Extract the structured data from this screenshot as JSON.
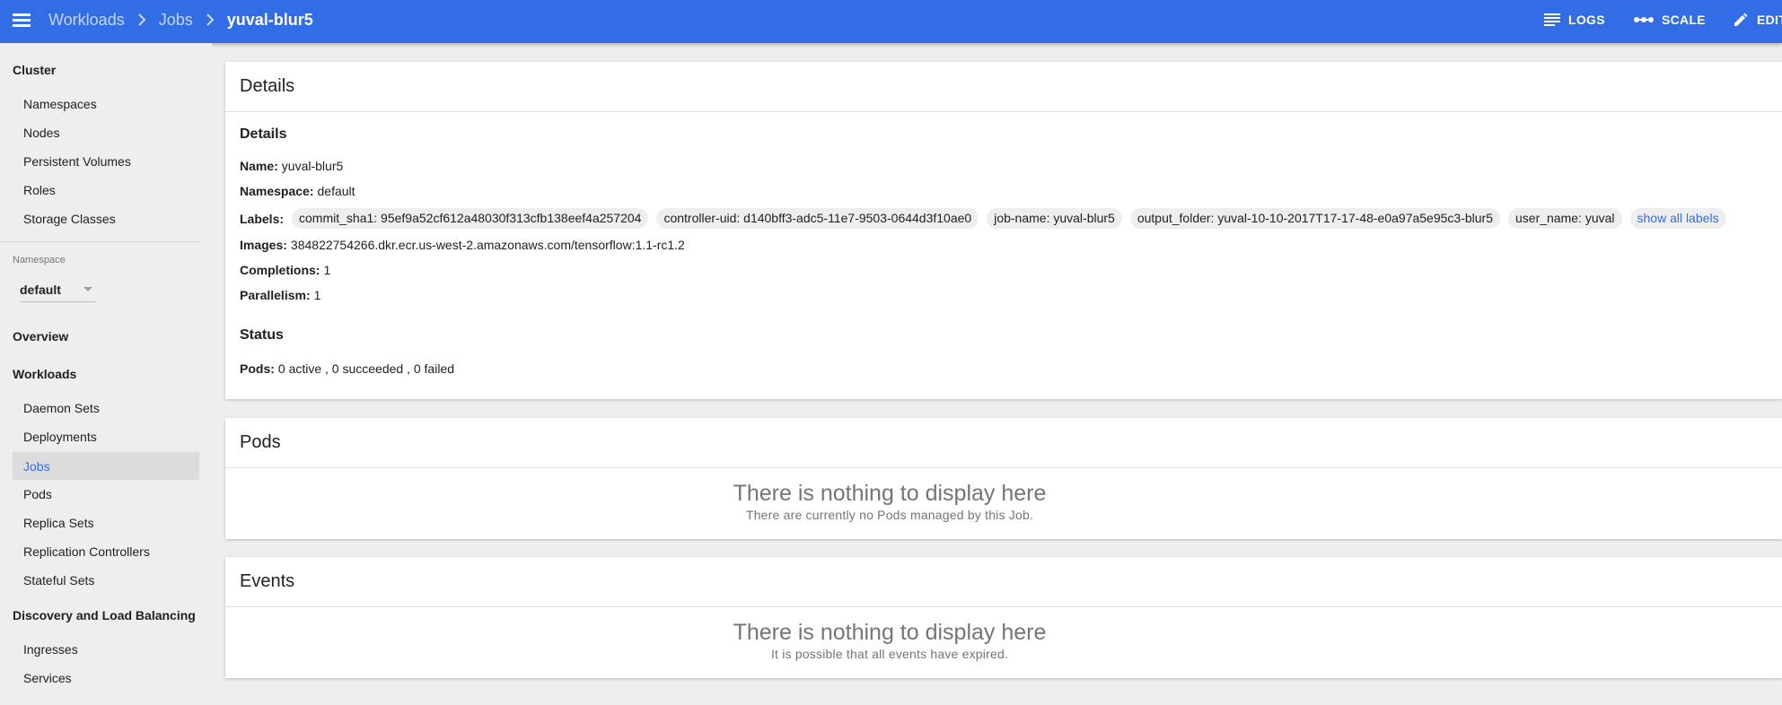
{
  "topbar": {
    "breadcrumbs": [
      "Workloads",
      "Jobs"
    ],
    "current": "yuval-blur5",
    "actions": {
      "logs": "LOGS",
      "scale": "SCALE",
      "edit": "EDIT"
    }
  },
  "sidebar": {
    "cluster": {
      "title": "Cluster",
      "items": [
        "Namespaces",
        "Nodes",
        "Persistent Volumes",
        "Roles",
        "Storage Classes"
      ]
    },
    "namespace": {
      "label": "Namespace",
      "value": "default"
    },
    "overview": "Overview",
    "workloads": {
      "title": "Workloads",
      "items": [
        "Daemon Sets",
        "Deployments",
        "Jobs",
        "Pods",
        "Replica Sets",
        "Replication Controllers",
        "Stateful Sets"
      ],
      "active": "Jobs"
    },
    "discovery": {
      "title": "Discovery and Load Balancing",
      "items": [
        "Ingresses",
        "Services"
      ]
    }
  },
  "details_card": {
    "title": "Details",
    "subtitle": "Details",
    "name": {
      "key": "Name:",
      "value": "yuval-blur5"
    },
    "namespace": {
      "key": "Namespace:",
      "value": "default"
    },
    "labels": {
      "key": "Labels:",
      "items": [
        "commit_sha1: 95ef9a52cf612a48030f313cfb138eef4a257204",
        "controller-uid: d140bff3-adc5-11e7-9503-0644d3f10ae0",
        "job-name: yuval-blur5",
        "output_folder: yuval-10-10-2017T17-17-48-e0a97a5e95c3-blur5",
        "user_name: yuval"
      ],
      "show_all": "show all labels"
    },
    "images": {
      "key": "Images:",
      "value": "384822754266.dkr.ecr.us-west-2.amazonaws.com/tensorflow:1.1-rc1.2"
    },
    "completions": {
      "key": "Completions:",
      "value": "1"
    },
    "parallelism": {
      "key": "Parallelism:",
      "value": "1"
    },
    "status_title": "Status",
    "pods": {
      "key": "Pods:",
      "value": "0 active , 0 succeeded , 0 failed"
    }
  },
  "pods_card": {
    "title": "Pods",
    "empty_title": "There is nothing to display here",
    "empty_sub": "There are currently no Pods managed by this Job."
  },
  "events_card": {
    "title": "Events",
    "empty_title": "There is nothing to display here",
    "empty_sub": "It is possible that all events have expired."
  },
  "colors": {
    "primary": "#326de6",
    "background": "#eeeeee",
    "active_bg": "#dcdcdc"
  }
}
